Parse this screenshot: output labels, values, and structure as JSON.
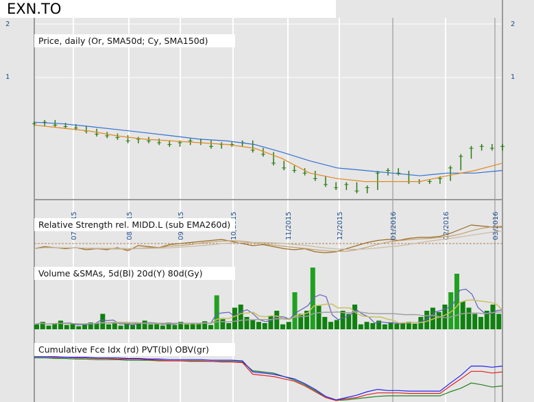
{
  "title": "EXN.TO",
  "panels": {
    "price": "Price, daily (Or, SMA50d; Cy, SMA150d)",
    "rs": "Relative Strength rel. MIDD.L (sub EMA260d)",
    "volume": "Volume &SMAs, 5d(Bl) 20d(Y) 80d(Gy)",
    "cfi": "Cumulative Fce Idx (rd) PVT(bl) OBV(gr)"
  },
  "colors": {
    "price": "#2a7a10",
    "sma50": "#e08a20",
    "sma150": "#3070d0",
    "rs": "#9a6a20",
    "vol": "#108010",
    "cfi": "#e02020",
    "pvt": "#2020f0",
    "obv": "#208020"
  },
  "chart_data": {
    "type": "line",
    "title": "EXN.TO",
    "yscale": "log",
    "y_ticks": [
      "2",
      "1"
    ],
    "x_ticks": [
      "07/2015",
      "08/2015",
      "09/2015",
      "10/2015",
      "11/2015",
      "12/2015",
      "01/2016",
      "02/2016",
      "03/2016"
    ],
    "price": [
      0.55,
      0.56,
      0.54,
      0.53,
      0.52,
      0.5,
      0.48,
      0.47,
      0.46,
      0.44,
      0.45,
      0.44,
      0.43,
      0.42,
      0.43,
      0.44,
      0.43,
      0.41,
      0.42,
      0.42,
      0.43,
      0.39,
      0.37,
      0.33,
      0.31,
      0.3,
      0.29,
      0.27,
      0.25,
      0.24,
      0.25,
      0.23,
      0.24,
      0.29,
      0.3,
      0.29,
      0.26,
      0.26,
      0.26,
      0.27,
      0.31,
      0.36,
      0.4,
      0.41,
      0.4,
      0.41
    ],
    "sma50": [
      0.54,
      0.52,
      0.5,
      0.47,
      0.45,
      0.44,
      0.43,
      0.42,
      0.4,
      0.35,
      0.29,
      0.27,
      0.26,
      0.26,
      0.26,
      0.28,
      0.3,
      0.33
    ],
    "sma150": [
      0.56,
      0.55,
      0.53,
      0.51,
      0.49,
      0.47,
      0.45,
      0.44,
      0.42,
      0.38,
      0.34,
      0.31,
      0.3,
      0.29,
      0.28,
      0.29,
      0.29,
      0.3
    ],
    "rs": [
      -5,
      -3,
      -4,
      -5,
      -4,
      -6,
      -5,
      -6,
      -4,
      -7,
      -2,
      -3,
      -4,
      -1,
      0,
      1,
      2,
      3,
      4,
      2,
      0,
      -2,
      -1,
      -3,
      -5,
      -6,
      -5,
      -8,
      -9,
      -8,
      -5,
      -2,
      1,
      3,
      4,
      3,
      5,
      6,
      6,
      7,
      10,
      14,
      18,
      17,
      16,
      16
    ],
    "volume": [
      8,
      12,
      6,
      9,
      14,
      7,
      10,
      5,
      8,
      11,
      9,
      25,
      8,
      12,
      6,
      9,
      7,
      10,
      14,
      8,
      9,
      6,
      11,
      7,
      12,
      8,
      10,
      9,
      13,
      7,
      55,
      18,
      10,
      35,
      40,
      20,
      15,
      12,
      10,
      22,
      30,
      8,
      12,
      60,
      25,
      30,
      100,
      38,
      20,
      12,
      15,
      30,
      25,
      40,
      8,
      12,
      10,
      14,
      8,
      10,
      9,
      11,
      12,
      9,
      20,
      30,
      35,
      28,
      40,
      60,
      90,
      45,
      35,
      25,
      20,
      30,
      40,
      25
    ],
    "cfi": [
      100,
      100,
      99,
      99,
      98,
      98,
      97,
      97,
      96,
      96,
      96,
      95,
      94,
      93,
      93,
      92,
      92,
      92,
      91,
      91,
      90,
      70,
      68,
      66,
      62,
      58,
      50,
      40,
      30,
      25,
      28,
      30,
      35,
      38,
      38,
      38,
      37,
      37,
      37,
      37,
      50,
      62,
      75,
      75,
      72,
      74
    ],
    "pvt": [
      100,
      100,
      100,
      99,
      99,
      99,
      98,
      98,
      98,
      97,
      97,
      96,
      96,
      95,
      95,
      95,
      95,
      94,
      94,
      94,
      93,
      74,
      72,
      70,
      66,
      62,
      54,
      44,
      32,
      26,
      30,
      34,
      40,
      44,
      42,
      42,
      41,
      41,
      41,
      41,
      55,
      68,
      84,
      84,
      82,
      84
    ],
    "obv": [
      98,
      98,
      97,
      97,
      96,
      96,
      95,
      95,
      95,
      94,
      94,
      94,
      93,
      93,
      93,
      93,
      93,
      92,
      92,
      92,
      91,
      76,
      74,
      72,
      66,
      60,
      52,
      42,
      30,
      25,
      26,
      28,
      30,
      32,
      33,
      33,
      33,
      33,
      33,
      33,
      40,
      46,
      55,
      52,
      48,
      50
    ]
  }
}
